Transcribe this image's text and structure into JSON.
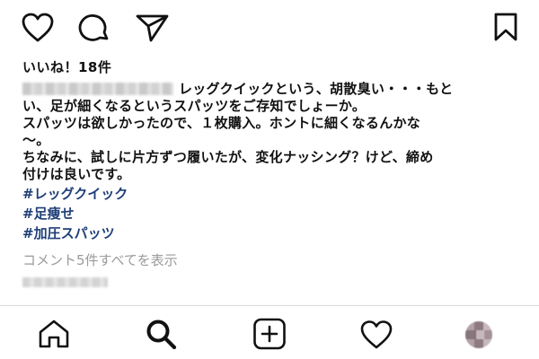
{
  "post": {
    "likes_label": "いいね！18件",
    "caption": {
      "line1": "レッグクイックという、胡散臭い・・・もと",
      "line2": "い、足が細くなるというスパッツをご存知でしょーか。",
      "line3": "スパッツは欲しかったので、１枚購入。ホントに細くなるんかな",
      "line4": "〜。",
      "line5": "ちなみに、試しに片方ずつ履いたが、変化ナッシング？けど、締め",
      "line6": "付けは良いです。"
    },
    "hashtags": [
      "#レッグクイック",
      "#足痩せ",
      "#加圧スパッツ"
    ],
    "view_comments_label": "コメント5件すべてを表示"
  },
  "actions": {
    "icons": [
      "heart-icon",
      "comment-icon",
      "share-icon",
      "bookmark-icon"
    ]
  },
  "bottom_nav": {
    "icons": [
      "home-icon",
      "search-icon",
      "new-post-icon",
      "activity-icon",
      "profile-avatar"
    ]
  }
}
